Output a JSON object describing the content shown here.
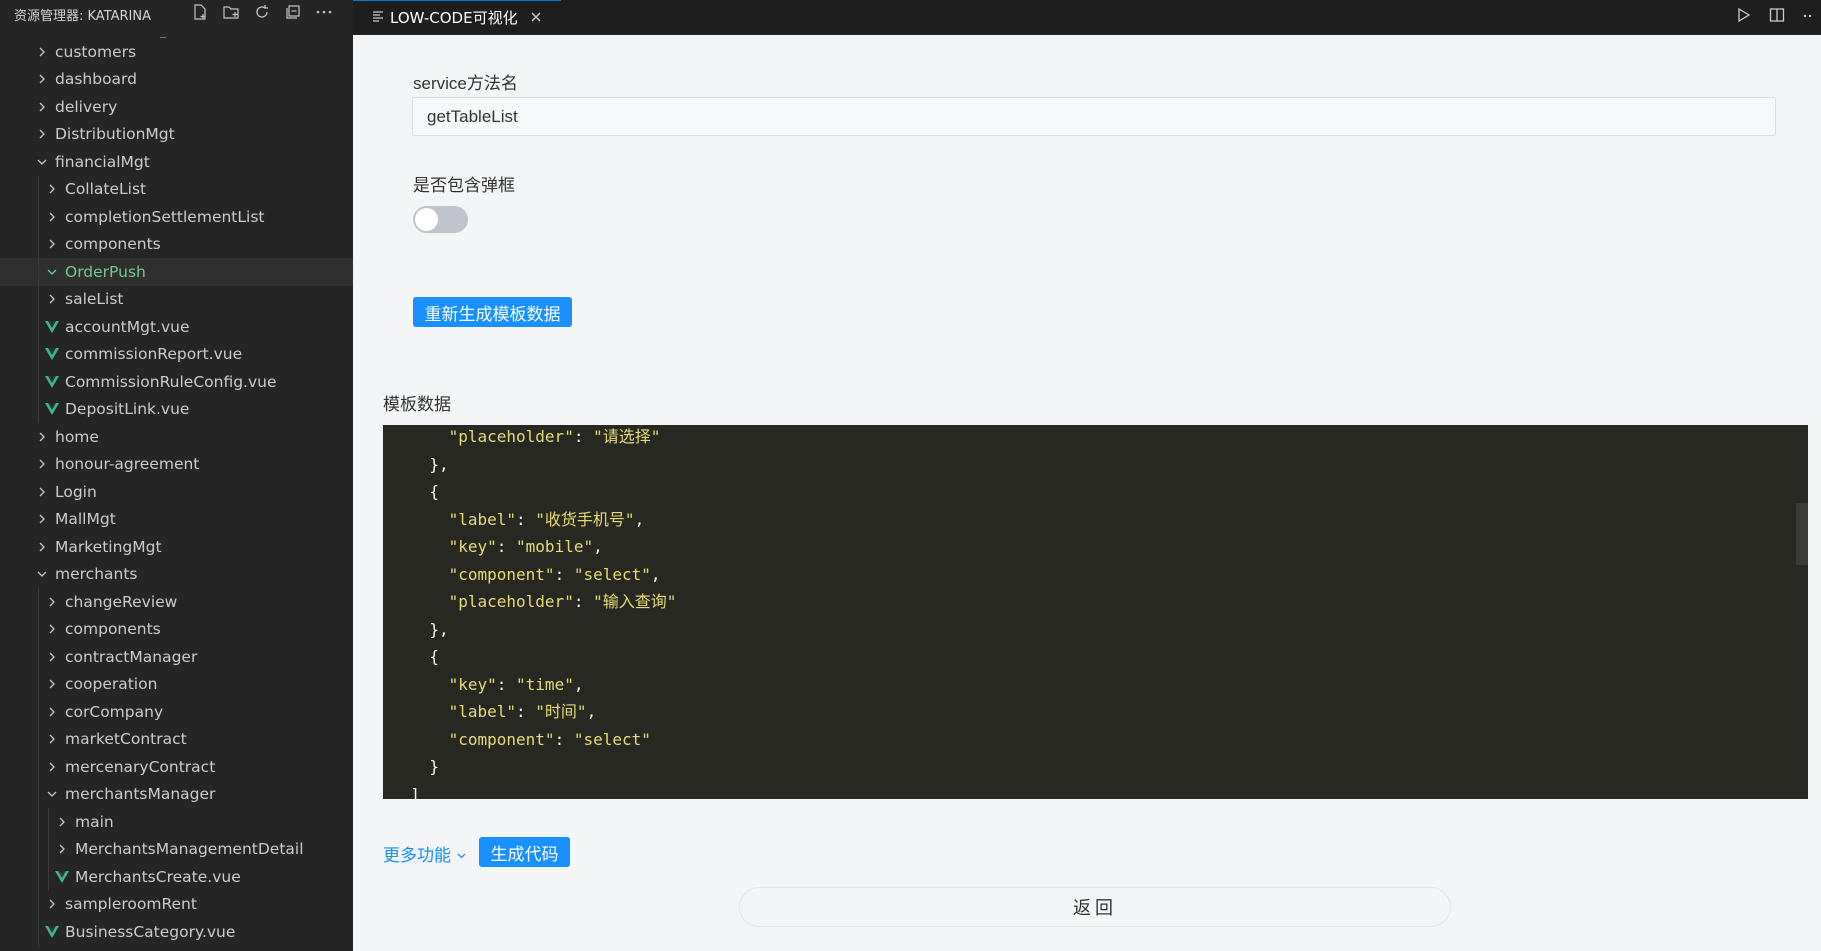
{
  "sidebar": {
    "title": "资源管理器: KATARINA",
    "items": [
      {
        "label": "customers",
        "type": "folder",
        "level": 0,
        "expanded": false
      },
      {
        "label": "dashboard",
        "type": "folder",
        "level": 0,
        "expanded": false
      },
      {
        "label": "delivery",
        "type": "folder",
        "level": 0,
        "expanded": false
      },
      {
        "label": "DistributionMgt",
        "type": "folder",
        "level": 0,
        "expanded": false
      },
      {
        "label": "financialMgt",
        "type": "folder",
        "level": 0,
        "expanded": true
      },
      {
        "label": "CollateList",
        "type": "folder",
        "level": 1,
        "expanded": false
      },
      {
        "label": "completionSettlementList",
        "type": "folder",
        "level": 1,
        "expanded": false
      },
      {
        "label": "components",
        "type": "folder",
        "level": 1,
        "expanded": false
      },
      {
        "label": "OrderPush",
        "type": "folder",
        "level": 1,
        "expanded": true,
        "selected": true
      },
      {
        "label": "saleList",
        "type": "folder",
        "level": 1,
        "expanded": false
      },
      {
        "label": "accountMgt.vue",
        "type": "vue",
        "level": 1
      },
      {
        "label": "commissionReport.vue",
        "type": "vue",
        "level": 1
      },
      {
        "label": "CommissionRuleConfig.vue",
        "type": "vue",
        "level": 1
      },
      {
        "label": "DepositLink.vue",
        "type": "vue",
        "level": 1
      },
      {
        "label": "home",
        "type": "folder",
        "level": 0,
        "expanded": false
      },
      {
        "label": "honour-agreement",
        "type": "folder",
        "level": 0,
        "expanded": false
      },
      {
        "label": "Login",
        "type": "folder",
        "level": 0,
        "expanded": false
      },
      {
        "label": "MallMgt",
        "type": "folder",
        "level": 0,
        "expanded": false
      },
      {
        "label": "MarketingMgt",
        "type": "folder",
        "level": 0,
        "expanded": false
      },
      {
        "label": "merchants",
        "type": "folder",
        "level": 0,
        "expanded": true
      },
      {
        "label": "changeReview",
        "type": "folder",
        "level": 1,
        "expanded": false
      },
      {
        "label": "components",
        "type": "folder",
        "level": 1,
        "expanded": false
      },
      {
        "label": "contractManager",
        "type": "folder",
        "level": 1,
        "expanded": false
      },
      {
        "label": "cooperation",
        "type": "folder",
        "level": 1,
        "expanded": false
      },
      {
        "label": "corCompany",
        "type": "folder",
        "level": 1,
        "expanded": false
      },
      {
        "label": "marketContract",
        "type": "folder",
        "level": 1,
        "expanded": false
      },
      {
        "label": "mercenaryContract",
        "type": "folder",
        "level": 1,
        "expanded": false
      },
      {
        "label": "merchantsManager",
        "type": "folder",
        "level": 1,
        "expanded": true
      },
      {
        "label": "main",
        "type": "folder",
        "level": 2,
        "expanded": false
      },
      {
        "label": "MerchantsManagementDetail",
        "type": "folder",
        "level": 2,
        "expanded": false
      },
      {
        "label": "MerchantsCreate.vue",
        "type": "vue",
        "level": 2
      },
      {
        "label": "sampleroomRent",
        "type": "folder",
        "level": 1,
        "expanded": false
      },
      {
        "label": "BusinessCategory.vue",
        "type": "vue",
        "level": 1
      }
    ]
  },
  "tab": {
    "label": "LOW-CODE可视化"
  },
  "form": {
    "service_label": "service方法名",
    "service_value": "getTableList",
    "dialog_label": "是否包含弹框",
    "dialog_enabled": false,
    "regen_button": "重新生成模板数据",
    "template_label": "模板数据"
  },
  "code_lines": [
    {
      "indent": 6,
      "parts": [
        [
          "k",
          "\"placeholder\""
        ],
        [
          "p",
          ": "
        ],
        [
          "s",
          "\"请选择\""
        ]
      ]
    },
    {
      "indent": 4,
      "parts": [
        [
          "p",
          "},"
        ]
      ]
    },
    {
      "indent": 4,
      "parts": [
        [
          "p",
          "{"
        ]
      ]
    },
    {
      "indent": 6,
      "parts": [
        [
          "k",
          "\"label\""
        ],
        [
          "p",
          ": "
        ],
        [
          "s",
          "\"收货手机号\""
        ],
        [
          "p",
          ","
        ]
      ]
    },
    {
      "indent": 6,
      "parts": [
        [
          "k",
          "\"key\""
        ],
        [
          "p",
          ": "
        ],
        [
          "s",
          "\"mobile\""
        ],
        [
          "p",
          ","
        ]
      ]
    },
    {
      "indent": 6,
      "parts": [
        [
          "k",
          "\"component\""
        ],
        [
          "p",
          ": "
        ],
        [
          "s",
          "\"select\""
        ],
        [
          "p",
          ","
        ]
      ]
    },
    {
      "indent": 6,
      "parts": [
        [
          "k",
          "\"placeholder\""
        ],
        [
          "p",
          ": "
        ],
        [
          "s",
          "\"输入查询\""
        ]
      ]
    },
    {
      "indent": 4,
      "parts": [
        [
          "p",
          "},"
        ]
      ]
    },
    {
      "indent": 4,
      "parts": [
        [
          "p",
          "{"
        ]
      ]
    },
    {
      "indent": 6,
      "parts": [
        [
          "k",
          "\"key\""
        ],
        [
          "p",
          ": "
        ],
        [
          "s",
          "\"time\""
        ],
        [
          "p",
          ","
        ]
      ]
    },
    {
      "indent": 6,
      "parts": [
        [
          "k",
          "\"label\""
        ],
        [
          "p",
          ": "
        ],
        [
          "s",
          "\"时间\""
        ],
        [
          "p",
          ","
        ]
      ]
    },
    {
      "indent": 6,
      "parts": [
        [
          "k",
          "\"component\""
        ],
        [
          "p",
          ": "
        ],
        [
          "s",
          "\"select\""
        ]
      ]
    },
    {
      "indent": 4,
      "parts": [
        [
          "p",
          "}"
        ]
      ]
    },
    {
      "indent": 2,
      "parts": [
        [
          "p",
          "]"
        ]
      ]
    }
  ],
  "footer": {
    "more_label": "更多功能",
    "generate_button": "生成代码",
    "back_button": "返回"
  },
  "colors": {
    "primary": "#1890ff",
    "vue_green": "#41b883",
    "selected_text": "#73c991"
  }
}
